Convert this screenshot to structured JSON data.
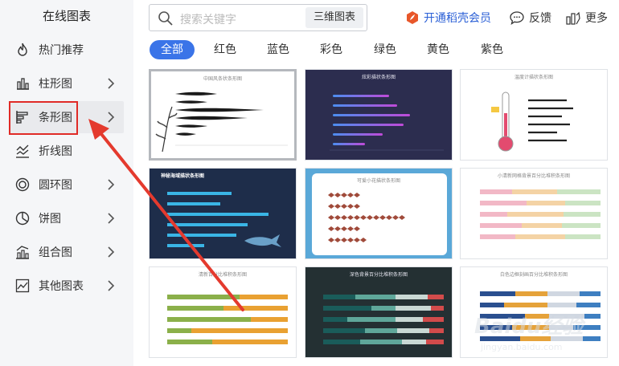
{
  "sidebar": {
    "title": "在线图表",
    "items": [
      {
        "label": "热门推荐"
      },
      {
        "label": "柱形图"
      },
      {
        "label": "条形图"
      },
      {
        "label": "折线图"
      },
      {
        "label": "圆环图"
      },
      {
        "label": "饼图"
      },
      {
        "label": "组合图"
      },
      {
        "label": "其他图表"
      }
    ]
  },
  "search": {
    "placeholder": "搜索关键字",
    "tag": "三维图表"
  },
  "topbar": {
    "vip": "开通稻壳会员",
    "feedback": "反馈",
    "more": "更多"
  },
  "colors": {
    "accent": "#3a74e8",
    "highlight": "#e02b27",
    "vip": "#2a5fd6"
  },
  "tabs": [
    "全部",
    "红色",
    "蓝色",
    "彩色",
    "绿色",
    "黄色",
    "紫色"
  ],
  "cards": [
    {
      "title": "中国风条状条形图"
    },
    {
      "title": "炫彩描状条形图"
    },
    {
      "title": "温度计描状条形图"
    },
    {
      "title": "神秘海域描状条形图"
    },
    {
      "title": "可爱小花描状条形图"
    },
    {
      "title": "小清新网格背景百分比堆积条形图"
    },
    {
      "title": "清新百分比堆积条形图"
    },
    {
      "title": "深色背景百分比堆积条形图"
    },
    {
      "title": "白色边框刻画百分比堆积条形图"
    }
  ],
  "watermark": {
    "brand": "Baidu经验",
    "url": "jingyan.baidu.com"
  }
}
